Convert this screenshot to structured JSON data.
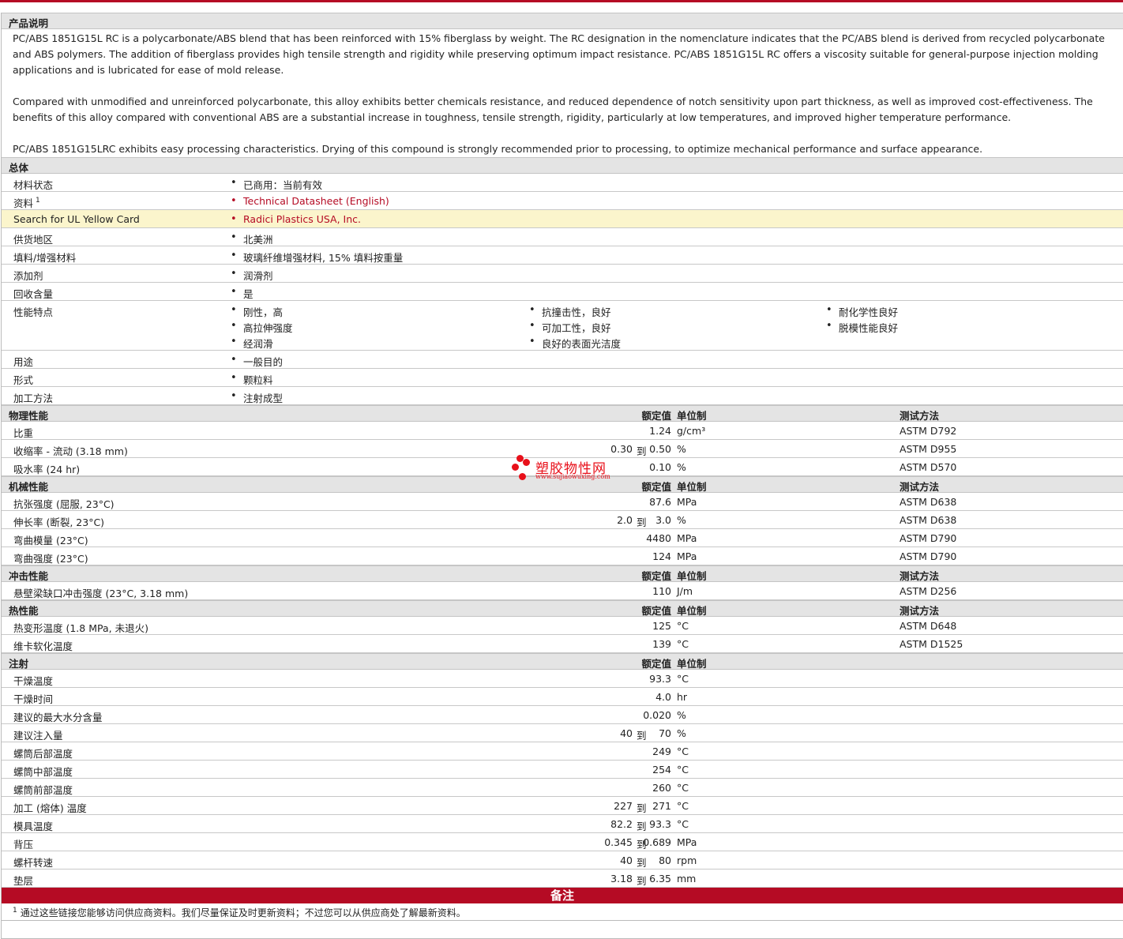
{
  "description": {
    "title": "产品说明",
    "paragraphs": [
      "PC/ABS 1851G15L RC is a polycarbonate/ABS blend that has been reinforced with 15% fiberglass by weight. The RC designation in the nomenclature indicates that the PC/ABS blend is derived from recycled polycarbonate and ABS polymers. The addition of fiberglass provides high tensile strength and rigidity while preserving optimum impact resistance. PC/ABS 1851G15L RC offers a viscosity suitable for general-purpose injection molding applications and is lubricated for ease of mold release.",
      "Compared with unmodified and unreinforced polycarbonate, this alloy exhibits better chemicals resistance, and reduced dependence of notch sensitivity upon part thickness, as well as improved cost-effectiveness. The benefits of this alloy compared with conventional ABS are a substantial increase in toughness, tensile strength, rigidity, particularly at low temperatures, and improved higher temperature performance.",
      "PC/ABS 1851G15LRC exhibits easy processing characteristics. Drying of this compound is strongly recommended prior to processing, to optimize mechanical performance and surface appearance."
    ]
  },
  "general": {
    "title": "总体",
    "rows": [
      {
        "label": "材料状态",
        "values": [
          "已商用：当前有效"
        ]
      },
      {
        "label": "资料",
        "sup": "1",
        "values": [
          "Technical Datasheet (English)"
        ],
        "link": true
      },
      {
        "label": "Search for UL Yellow Card",
        "values": [
          "Radici Plastics USA, Inc."
        ],
        "link": true,
        "highlight": true
      },
      {
        "label": "供货地区",
        "values": [
          "北美洲"
        ]
      },
      {
        "label": "填料/增强材料",
        "values": [
          "玻璃纤维增强材料, 15% 填料按重量"
        ]
      },
      {
        "label": "添加剂",
        "values": [
          "润滑剂"
        ]
      },
      {
        "label": "回收含量",
        "values": [
          "是"
        ]
      },
      {
        "label": "性能特点",
        "columns": [
          [
            "刚性，高",
            "高拉伸强度",
            "经润滑"
          ],
          [
            "抗撞击性，良好",
            "可加工性，良好",
            "良好的表面光洁度"
          ],
          [
            "耐化学性良好",
            "脱模性能良好"
          ]
        ]
      },
      {
        "label": "用途",
        "values": [
          "一般目的"
        ]
      },
      {
        "label": "形式",
        "values": [
          "颗粒料"
        ]
      },
      {
        "label": "加工方法",
        "values": [
          "注射成型"
        ]
      }
    ]
  },
  "headers": {
    "nominal": "额定值",
    "unit": "单位制",
    "test": "测试方法",
    "range_word": "到"
  },
  "sections": [
    {
      "title": "物理性能",
      "test_col": true,
      "rows": [
        {
          "label": "比重",
          "value": "1.24",
          "unit": "g/cm³",
          "test": "ASTM D792"
        },
        {
          "label": "收缩率 - 流动 (3.18 mm)",
          "low": "0.30",
          "high": "0.50",
          "unit": "%",
          "test": "ASTM D955"
        },
        {
          "label": "吸水率 (24 hr)",
          "value": "0.10",
          "unit": "%",
          "test": "ASTM D570"
        }
      ]
    },
    {
      "title": "机械性能",
      "test_col": true,
      "rows": [
        {
          "label": "抗张强度 (屈服, 23°C)",
          "value": "87.6",
          "unit": "MPa",
          "test": "ASTM D638"
        },
        {
          "label": "伸长率 (断裂, 23°C)",
          "low": "2.0",
          "high": "3.0",
          "unit": "%",
          "test": "ASTM D638"
        },
        {
          "label": "弯曲模量 (23°C)",
          "value": "4480",
          "unit": "MPa",
          "test": "ASTM D790"
        },
        {
          "label": "弯曲强度 (23°C)",
          "value": "124",
          "unit": "MPa",
          "test": "ASTM D790"
        }
      ]
    },
    {
      "title": "冲击性能",
      "test_col": true,
      "rows": [
        {
          "label": "悬壁梁缺口冲击强度 (23°C, 3.18 mm)",
          "value": "110",
          "unit": "J/m",
          "test": "ASTM D256"
        }
      ]
    },
    {
      "title": "热性能",
      "test_col": true,
      "rows": [
        {
          "label": "热变形温度 (1.8 MPa, 未退火)",
          "value": "125",
          "unit": "°C",
          "test": "ASTM D648"
        },
        {
          "label": "维卡软化温度",
          "value": "139",
          "unit": "°C",
          "test": "ASTM D1525"
        }
      ]
    },
    {
      "title": "注射",
      "test_col": false,
      "rows": [
        {
          "label": "干燥温度",
          "value": "93.3",
          "unit": "°C"
        },
        {
          "label": "干燥时间",
          "value": "4.0",
          "unit": "hr"
        },
        {
          "label": "建议的最大水分含量",
          "value": "0.020",
          "unit": "%"
        },
        {
          "label": "建议注入量",
          "low": "40",
          "high": "70",
          "unit": "%"
        },
        {
          "label": "螺筒后部温度",
          "value": "249",
          "unit": "°C"
        },
        {
          "label": "螺筒中部温度",
          "value": "254",
          "unit": "°C"
        },
        {
          "label": "螺筒前部温度",
          "value": "260",
          "unit": "°C"
        },
        {
          "label": "加工 (熔体) 温度",
          "low": "227",
          "high": "271",
          "unit": "°C"
        },
        {
          "label": "模具温度",
          "low": "82.2",
          "high": "93.3",
          "unit": "°C"
        },
        {
          "label": "背压",
          "low": "0.345",
          "high": "0.689",
          "unit": "MPa"
        },
        {
          "label": "螺杆转速",
          "low": "40",
          "high": "80",
          "unit": "rpm"
        },
        {
          "label": "垫层",
          "low": "3.18",
          "high": "6.35",
          "unit": "mm"
        }
      ]
    }
  ],
  "notes": {
    "title": "备注",
    "footnote_mark": "1",
    "footnote": "通过这些链接您能够访问供应商资料。我们尽量保证及时更新资料；不过您可以从供应商处了解最新资料。"
  },
  "watermark": {
    "cn": "塑胶物性网",
    "en": "www.sujiaowuxing.com"
  }
}
